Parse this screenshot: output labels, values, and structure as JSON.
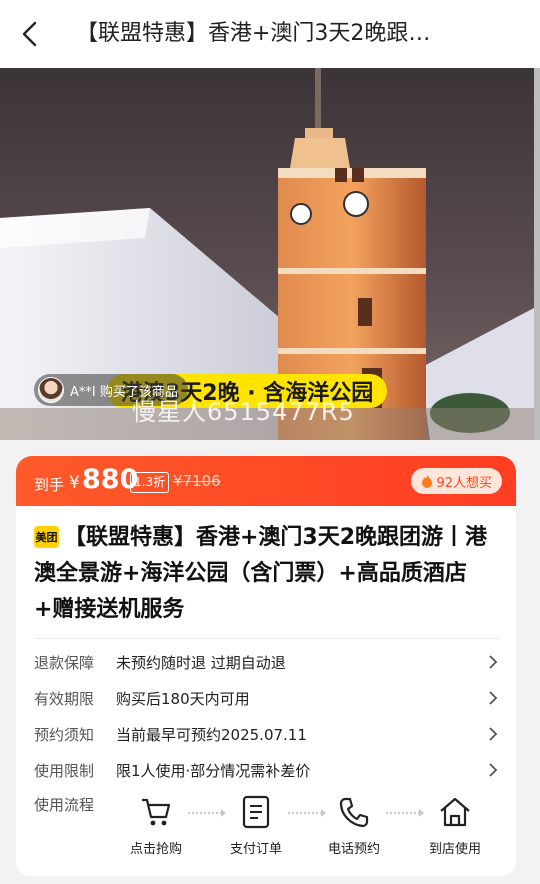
{
  "header": {
    "back_icon": "chevron-left-icon",
    "title": "【联盟特惠】香港+澳门3天2晚跟…"
  },
  "hero": {
    "buyer_notice": "A**I 购买了该商品",
    "promo_text": "港澳3天2晚 · 含海洋公园",
    "watermark": "慢星人6515477R5"
  },
  "price": {
    "label": "到手",
    "currency": "¥",
    "amount": "880",
    "discount": "1.3折",
    "original": "¥7106",
    "want_count": "92人想买",
    "want_icon": "fire-icon",
    "accent_color": "#ff4a22"
  },
  "product": {
    "brand_badge": "美团",
    "title": "【联盟特惠】香港+澳门3天2晚跟团游丨港澳全景游+海洋公园（含门票）+高品质酒店+赠接送机服务"
  },
  "info_rows": [
    {
      "label": "退款保障",
      "value": "未预约随时退 过期自动退"
    },
    {
      "label": "有效期限",
      "value": "购买后180天内可用"
    },
    {
      "label": "预约须知",
      "value": "当前最早可预约2025.07.11"
    },
    {
      "label": "使用限制",
      "value": "限1人使用·部分情况需补差价"
    }
  ],
  "flow": {
    "label": "使用流程",
    "steps": [
      {
        "label": "点击抢购",
        "icon": "cart-icon"
      },
      {
        "label": "支付订单",
        "icon": "document-icon"
      },
      {
        "label": "电话预约",
        "icon": "phone-icon"
      },
      {
        "label": "到店使用",
        "icon": "home-icon"
      }
    ]
  }
}
